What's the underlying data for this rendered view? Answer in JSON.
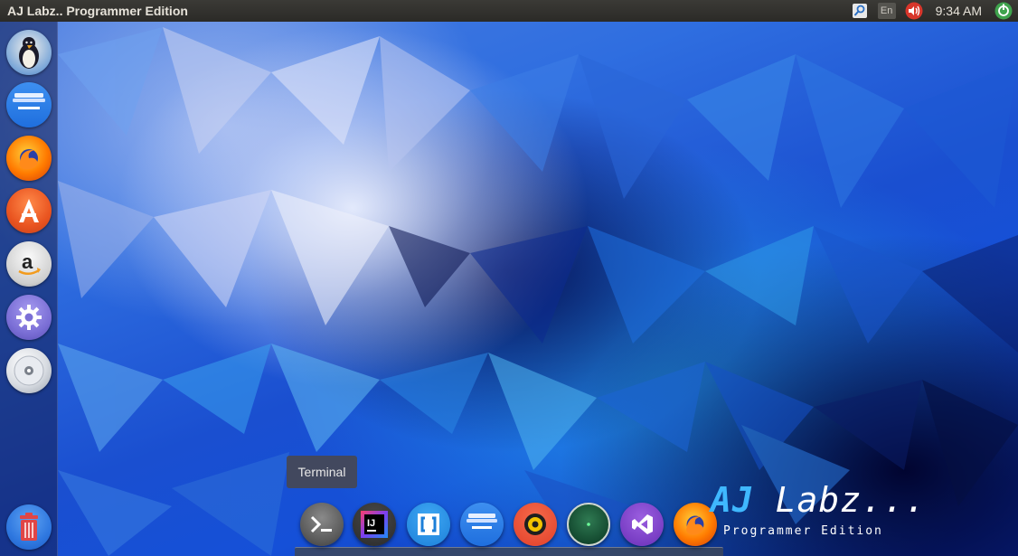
{
  "window": {
    "title": "AJ Labz.. Programmer Edition"
  },
  "panel": {
    "keyboard_layout": "En",
    "clock": "9:34 AM",
    "indicator_icons": [
      "search-indicator-icon",
      "keyboard-layout-indicator",
      "volume-icon",
      "session-menu-icon"
    ]
  },
  "launcher": {
    "items": [
      {
        "name": "user-avatar-icon"
      },
      {
        "name": "files-app-icon"
      },
      {
        "name": "firefox-icon"
      },
      {
        "name": "software-center-icon"
      },
      {
        "name": "amazon-icon"
      },
      {
        "name": "system-settings-icon"
      },
      {
        "name": "optical-disc-icon"
      },
      {
        "name": "trash-icon"
      }
    ]
  },
  "dock": {
    "tooltip": "Terminal",
    "items": [
      {
        "name": "terminal-icon"
      },
      {
        "name": "intellij-idea-icon"
      },
      {
        "name": "brackets-icon"
      },
      {
        "name": "files-app-icon"
      },
      {
        "name": "music-player-icon"
      },
      {
        "name": "radar-app-icon"
      },
      {
        "name": "visual-studio-code-icon"
      },
      {
        "name": "firefox-icon"
      }
    ]
  },
  "brand": {
    "title_prefix": "AJ",
    "title_rest": "Labz...",
    "subtitle": "Programmer Edition"
  },
  "colors": {
    "accent": "#3fb8ff",
    "panel_bg": "#2b2a27",
    "firefox_orange": "#e66000",
    "software_center_orange": "#e95420",
    "settings_purple": "#7b6fd6",
    "trash_red": "#e04646",
    "vscode_purple": "#7a3fc4"
  }
}
